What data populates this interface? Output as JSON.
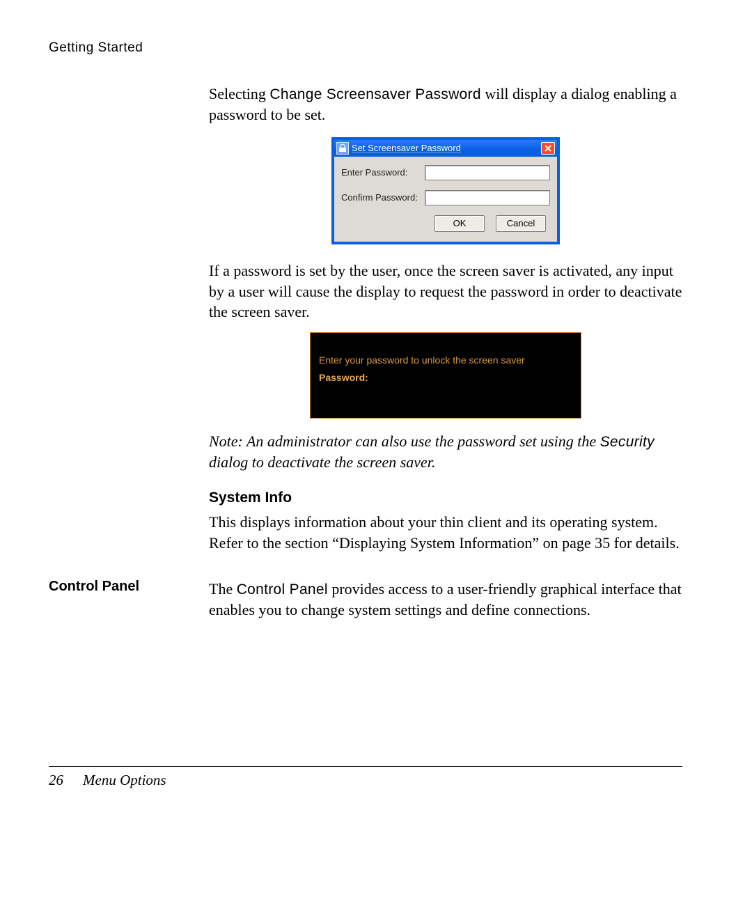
{
  "header": {
    "title": "Getting Started"
  },
  "body": {
    "p1_a": "Selecting ",
    "p1_mono": "Change Screensaver Password",
    "p1_b": " will display a dialog enabling a password to be set.",
    "dialog": {
      "title": "Set Screensaver Password",
      "enter_label": "Enter Password:",
      "confirm_label": "Confirm Password:",
      "ok": "OK",
      "cancel": "Cancel"
    },
    "p2": "If a password is set by the user, once the screen saver is activated, any input by a user will cause the display to request the password in order to deactivate the screen saver.",
    "lock": {
      "line1": "Enter your password to unlock the screen saver",
      "line2": "Password:"
    },
    "note_a": "Note: An administrator can also use the password set using the ",
    "note_mono": "Security",
    "note_b": " dialog to deactivate the screen saver.",
    "sysinfo_h": "System Info",
    "sysinfo_p": "This displays information about your thin client and its operating system. Refer to the section “Displaying System Information” on page 35 for details.",
    "cp_side": "Control Panel",
    "cp_a": "The ",
    "cp_mono": "Control Panel",
    "cp_b": " provides access to a user-friendly graphical interface that enables you to change system settings and define connections."
  },
  "footer": {
    "page": "26",
    "section": "Menu Options"
  }
}
